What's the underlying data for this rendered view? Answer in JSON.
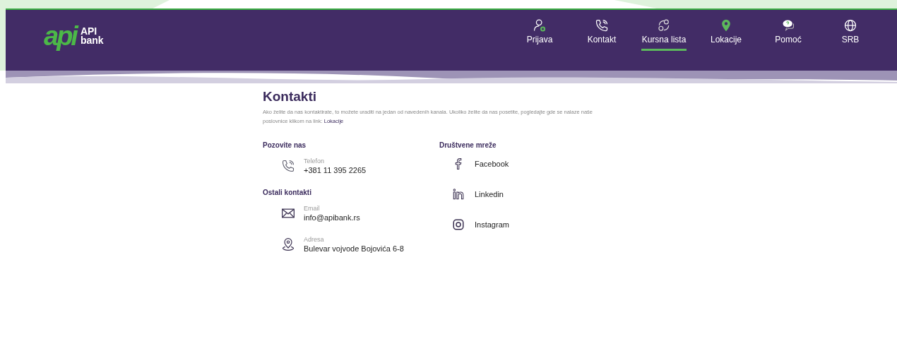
{
  "logo": {
    "mark": "api",
    "name_line1": "API",
    "name_line2": "bank"
  },
  "nav": [
    {
      "label": "Prijava",
      "kind": "user",
      "selected": false
    },
    {
      "label": "Kontakt",
      "kind": "phone",
      "selected": false
    },
    {
      "label": "Kursna lista",
      "kind": "exchange",
      "selected": true
    },
    {
      "label": "Lokacije",
      "kind": "pin",
      "selected": false
    },
    {
      "label": "Pomoć",
      "kind": "help",
      "selected": false
    },
    {
      "label": "SRB",
      "kind": "globe",
      "selected": false
    }
  ],
  "title": "Kontakti",
  "intro": {
    "text": "Ako želite da nas kontaktirate, to možete uraditi na jedan od navedenih kanala. Ukoliko želite da nas posetite, pogledajte gde se nalaze naše poslovnice klikom na link:",
    "link": "Lokacije"
  },
  "call_section": {
    "heading": "Pozovite nas",
    "items": [
      {
        "kind": "phone",
        "label": "Telefon",
        "value": "+381 11 395 2265"
      }
    ]
  },
  "other_section": {
    "heading": "Ostali kontakti",
    "items": [
      {
        "kind": "email",
        "label": "Email",
        "value": "info@apibank.rs"
      },
      {
        "kind": "address",
        "label": "Adresa",
        "value": "Bulevar vojvode Bojovića 6-8"
      }
    ]
  },
  "social_section": {
    "heading": "Društvene mreže",
    "items": [
      {
        "kind": "facebook",
        "label": "Facebook"
      },
      {
        "kind": "linkedin",
        "label": "Linkedin"
      },
      {
        "kind": "instagram",
        "label": "Instagram"
      }
    ]
  }
}
